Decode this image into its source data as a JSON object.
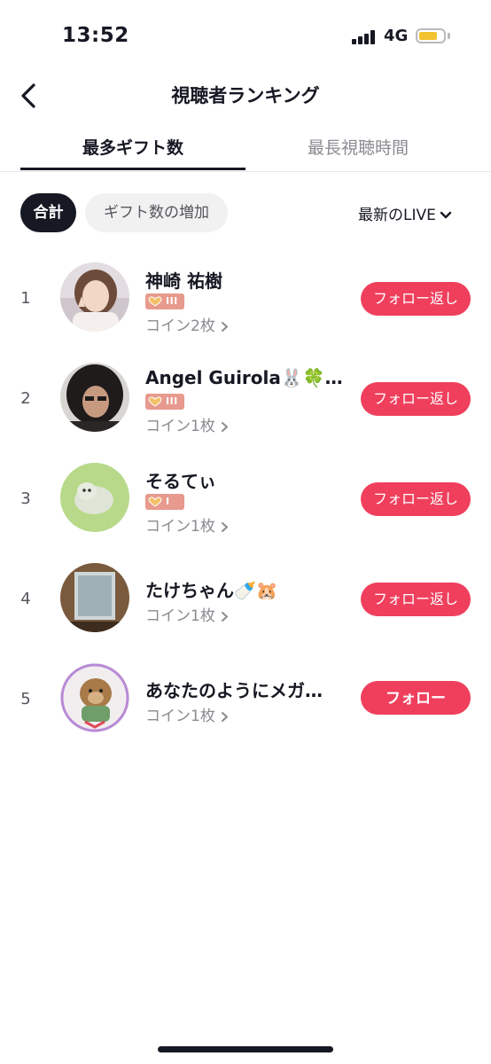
{
  "status": {
    "time": "13:52",
    "network": "4G"
  },
  "header": {
    "title": "視聴者ランキング"
  },
  "tabs": [
    {
      "label": "最多ギフト数",
      "active": true
    },
    {
      "label": "最長視聴時間",
      "active": false
    }
  ],
  "filters": {
    "total": "合計",
    "gift_increase": "ギフト数の増加",
    "live_select": "最新のLIVE"
  },
  "viewers": [
    {
      "rank": "1",
      "name": "神崎 祐樹",
      "badge": "III",
      "coins": "コイン2枚",
      "button": "フォロー返し"
    },
    {
      "rank": "2",
      "name": "Angel Guirola🐰🍀…",
      "badge": "III",
      "coins": "コイン1枚",
      "button": "フォロー返し"
    },
    {
      "rank": "3",
      "name": "そるてぃ",
      "badge": "I",
      "coins": "コイン1枚",
      "button": "フォロー返し"
    },
    {
      "rank": "4",
      "name": "たけちゃん🍼🐹",
      "coins": "コイン1枚",
      "button": "フォロー返し"
    },
    {
      "rank": "5",
      "name": "あなたのようにメガ…",
      "coins": "コイン1枚",
      "button": "フォロー"
    }
  ],
  "colors": {
    "accent": "#ef3f5d",
    "badge": "#e79a8d",
    "text": "#161823",
    "muted": "#8a8b91"
  },
  "icons": [
    "back-arrow-icon",
    "chevron-down-icon",
    "chevron-right-icon",
    "heart-icon",
    "signal-icon",
    "battery-icon"
  ]
}
